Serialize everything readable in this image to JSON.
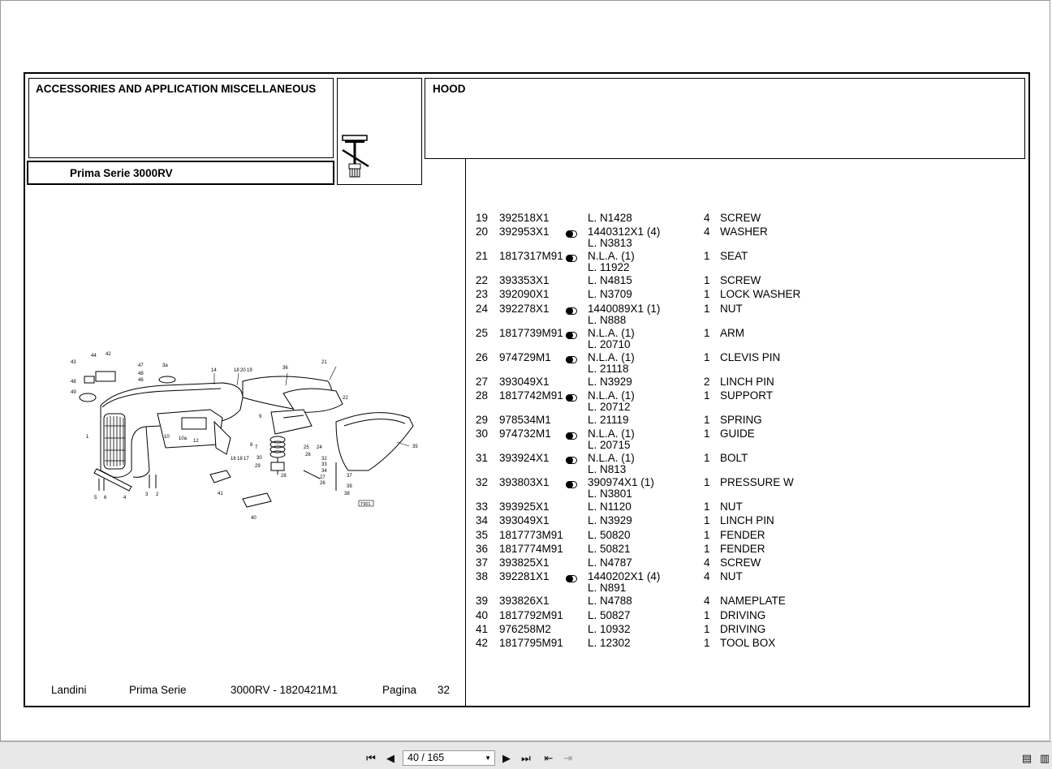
{
  "document": {
    "category_title": "ACCESSORIES AND APPLICATION MISCELLANEOUS",
    "model_title": "Prima Serie 3000RV",
    "section_title": "HOOD",
    "diagram_code": "T901",
    "footer": {
      "brand": "Landini",
      "series": "Prima Serie",
      "model_code": "3000RV - 1820421M1",
      "page_label": "Pagina",
      "page_number": "32"
    }
  },
  "parts": [
    {
      "num": "19",
      "part": "392518X1",
      "marker": false,
      "ref": [
        "L. N1428"
      ],
      "qty": "4",
      "desc": "SCREW"
    },
    {
      "num": "20",
      "part": "392953X1",
      "marker": true,
      "ref": [
        "1440312X1  (4)",
        "L. N3813"
      ],
      "qty": "4",
      "desc": "WASHER"
    },
    {
      "num": "21",
      "part": "1817317M91",
      "marker": true,
      "ref": [
        "N.L.A.  (1)",
        "L. 11922"
      ],
      "qty": "1",
      "desc": "SEAT"
    },
    {
      "num": "22",
      "part": "393353X1",
      "marker": false,
      "ref": [
        "L. N4815"
      ],
      "qty": "1",
      "desc": "SCREW"
    },
    {
      "num": "23",
      "part": "392090X1",
      "marker": false,
      "ref": [
        "L. N3709"
      ],
      "qty": "1",
      "desc": "LOCK WASHER"
    },
    {
      "num": "24",
      "part": "392278X1",
      "marker": true,
      "ref": [
        "1440089X1  (1)",
        "L. N888"
      ],
      "qty": "1",
      "desc": "NUT"
    },
    {
      "num": "25",
      "part": "1817739M91",
      "marker": true,
      "ref": [
        "N.L.A.  (1)",
        "L. 20710"
      ],
      "qty": "1",
      "desc": "ARM"
    },
    {
      "num": "26",
      "part": "974729M1",
      "marker": true,
      "ref": [
        "N.L.A.  (1)",
        "L. 21118"
      ],
      "qty": "1",
      "desc": "CLEVIS PIN"
    },
    {
      "num": "27",
      "part": "393049X1",
      "marker": false,
      "ref": [
        "L. N3929"
      ],
      "qty": "2",
      "desc": "LINCH PIN"
    },
    {
      "num": "28",
      "part": "1817742M91",
      "marker": true,
      "ref": [
        "N.L.A.  (1)",
        "L. 20712"
      ],
      "qty": "1",
      "desc": "SUPPORT"
    },
    {
      "num": "29",
      "part": "978534M1",
      "marker": false,
      "ref": [
        "L. 21119"
      ],
      "qty": "1",
      "desc": "SPRING"
    },
    {
      "num": "30",
      "part": "974732M1",
      "marker": true,
      "ref": [
        "N.L.A.  (1)",
        "L. 20715"
      ],
      "qty": "1",
      "desc": "GUIDE"
    },
    {
      "num": "31",
      "part": "393924X1",
      "marker": true,
      "ref": [
        "N.L.A.  (1)",
        "L. N813"
      ],
      "qty": "1",
      "desc": "BOLT"
    },
    {
      "num": "32",
      "part": "393803X1",
      "marker": true,
      "ref": [
        "390974X1  (1)",
        "L. N3801"
      ],
      "qty": "1",
      "desc": "PRESSURE W"
    },
    {
      "num": "33",
      "part": "393925X1",
      "marker": false,
      "ref": [
        "L. N1120"
      ],
      "qty": "1",
      "desc": "NUT"
    },
    {
      "num": "34",
      "part": "393049X1",
      "marker": false,
      "ref": [
        "L. N3929"
      ],
      "qty": "1",
      "desc": "LINCH PIN"
    },
    {
      "num": "35",
      "part": "1817773M91",
      "marker": false,
      "ref": [
        "L. 50820"
      ],
      "qty": "1",
      "desc": "FENDER"
    },
    {
      "num": "36",
      "part": "1817774M91",
      "marker": false,
      "ref": [
        "L. 50821"
      ],
      "qty": "1",
      "desc": "FENDER"
    },
    {
      "num": "37",
      "part": "393825X1",
      "marker": false,
      "ref": [
        "L. N4787"
      ],
      "qty": "4",
      "desc": "SCREW"
    },
    {
      "num": "38",
      "part": "392281X1",
      "marker": true,
      "ref": [
        "1440202X1  (4)",
        "L. N891"
      ],
      "qty": "4",
      "desc": "NUT"
    },
    {
      "num": "39",
      "part": "393826X1",
      "marker": false,
      "ref": [
        "L. N4788"
      ],
      "qty": "4",
      "desc": "NAMEPLATE"
    },
    {
      "num": "40",
      "part": "1817792M91",
      "marker": false,
      "ref": [
        "L. 50827"
      ],
      "qty": "1",
      "desc": "DRIVING"
    },
    {
      "num": "41",
      "part": "976258M2",
      "marker": false,
      "ref": [
        "L. 10932"
      ],
      "qty": "1",
      "desc": "DRIVING"
    },
    {
      "num": "42",
      "part": "1817795M91",
      "marker": false,
      "ref": [
        "L. 12302"
      ],
      "qty": "1",
      "desc": "TOOL BOX"
    }
  ],
  "viewer": {
    "page_indicator": "40 / 165",
    "icons": [
      "first-page-icon",
      "prev-page-icon",
      "next-page-icon",
      "last-page-icon",
      "go-back-icon",
      "go-forward-icon",
      "single-page-view-icon",
      "continuous-view-icon"
    ]
  }
}
